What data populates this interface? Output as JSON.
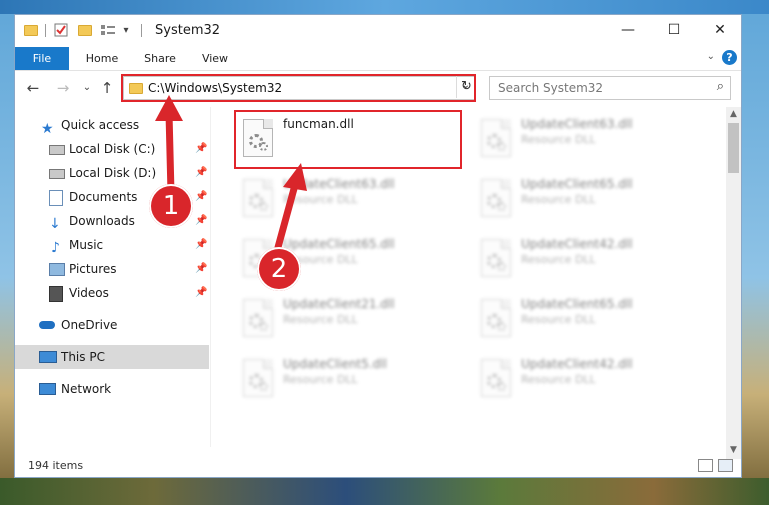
{
  "window": {
    "title": "System32",
    "quick_access_toolbar": [
      "folder-icon",
      "properties-icon",
      "new-folder-icon",
      "customize-icon"
    ],
    "controls": {
      "minimize": "—",
      "maximize": "☐",
      "close": "✕"
    }
  },
  "ribbon": {
    "tabs": [
      "File",
      "Home",
      "Share",
      "View"
    ],
    "help": "?",
    "expand": "⌄"
  },
  "nav": {
    "back": "←",
    "forward": "→",
    "recent": "⌄",
    "up": "↑",
    "address": "C:\\Windows\\System32",
    "refresh": "↻",
    "search_placeholder": "Search System32",
    "search_icon": "⌕"
  },
  "sidebar": {
    "items": [
      {
        "label": "Quick access",
        "icon": "star-icon",
        "pinned": false
      },
      {
        "label": "Local Disk (C:)",
        "icon": "drive-icon",
        "pinned": true
      },
      {
        "label": "Local Disk (D:)",
        "icon": "drive-icon",
        "pinned": true
      },
      {
        "label": "Documents",
        "icon": "documents-icon",
        "pinned": true
      },
      {
        "label": "Downloads",
        "icon": "downloads-icon",
        "pinned": true
      },
      {
        "label": "Music",
        "icon": "music-icon",
        "pinned": true
      },
      {
        "label": "Pictures",
        "icon": "pictures-icon",
        "pinned": true
      },
      {
        "label": "Videos",
        "icon": "videos-icon",
        "pinned": true
      },
      {
        "label": "OneDrive",
        "icon": "cloud-icon",
        "pinned": false
      },
      {
        "label": "This PC",
        "icon": "computer-icon",
        "pinned": false,
        "selected": true
      },
      {
        "label": "Network",
        "icon": "network-icon",
        "pinned": false
      }
    ],
    "pin_glyph": "📌"
  },
  "files": {
    "left": [
      {
        "name": "funcman.dll",
        "type": "",
        "highlighted": true
      },
      {
        "name": "UpdateClient63.dll",
        "type": "Resource DLL"
      },
      {
        "name": "UpdateClient65.dll",
        "type": "Resource DLL"
      },
      {
        "name": "UpdateClient21.dll",
        "type": "Resource DLL"
      },
      {
        "name": "UpdateClient5.dll",
        "type": "Resource DLL"
      }
    ],
    "right": [
      {
        "name": "UpdateClient63.dll",
        "type": "Resource DLL"
      },
      {
        "name": "UpdateClient65.dll",
        "type": "Resource DLL"
      },
      {
        "name": "UpdateClient42.dll",
        "type": "Resource DLL"
      },
      {
        "name": "UpdateClient65.dll",
        "type": "Resource DLL"
      },
      {
        "name": "UpdateClient42.dll",
        "type": "Resource DLL"
      }
    ]
  },
  "status": {
    "items_count": "194 items"
  },
  "callouts": [
    "1",
    "2"
  ],
  "colors": {
    "accent": "#1979ca",
    "highlight_red": "#e1252b",
    "callout_red": "#d9262b",
    "selected_bg": "#d9d9d9"
  }
}
